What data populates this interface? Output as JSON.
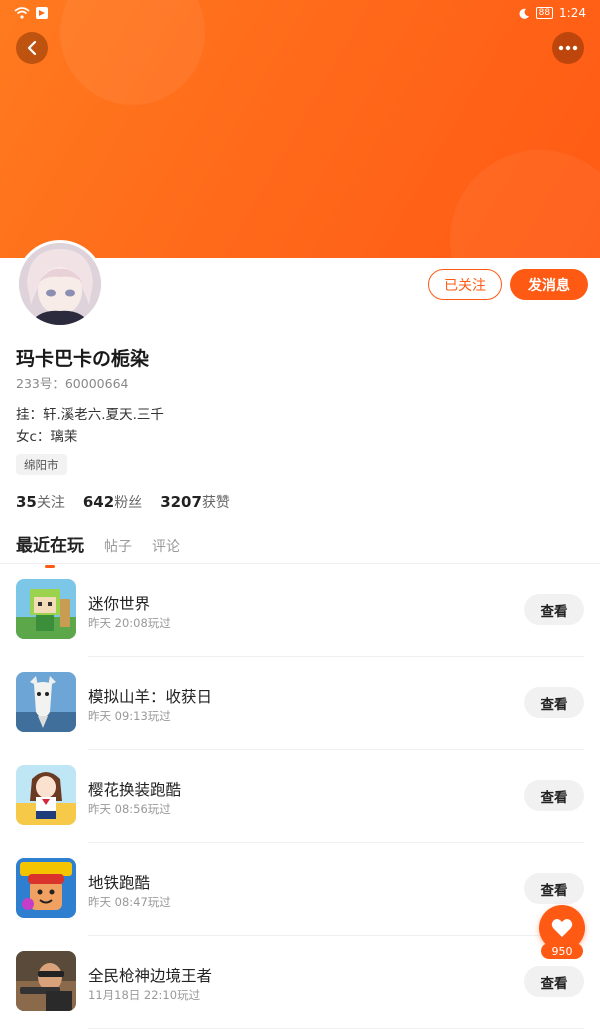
{
  "status_bar": {
    "time": "1:24",
    "battery": "88"
  },
  "profile": {
    "name": "玛卡巴卡の栀染",
    "uid": "233号：60000664",
    "bio_line1": "挂：轩.溪老六.夏天.三千",
    "bio_line2": "女c：璃茉",
    "city": "绵阳市"
  },
  "actions": {
    "followed_label": "已关注",
    "message_label": "发消息"
  },
  "stats": [
    {
      "count": "35",
      "label": "关注"
    },
    {
      "count": "642",
      "label": "粉丝"
    },
    {
      "count": "3207",
      "label": "获赞"
    }
  ],
  "tabs": [
    {
      "label": "最近在玩",
      "active": true
    },
    {
      "label": "帖子",
      "active": false
    },
    {
      "label": "评论",
      "active": false
    }
  ],
  "games": [
    {
      "title": "迷你世界",
      "played": "昨天 20:08玩过",
      "button": "查看",
      "icon": "mini-world-icon"
    },
    {
      "title": "模拟山羊：收获日",
      "played": "昨天 09:13玩过",
      "button": "查看",
      "icon": "goat-simulator-icon"
    },
    {
      "title": "樱花换装跑酷",
      "played": "昨天 08:56玩过",
      "button": "查看",
      "icon": "sakura-runner-icon"
    },
    {
      "title": "地铁跑酷",
      "played": "昨天 08:47玩过",
      "button": "查看",
      "icon": "subway-surfers-icon"
    },
    {
      "title": "全民枪神边境王者",
      "played": "11月18日 22:10玩过",
      "button": "查看",
      "icon": "gun-king-icon"
    }
  ],
  "floating": {
    "like_count": "950"
  },
  "colors": {
    "accent": "#ff5a14",
    "banner": "#ff6a1a"
  }
}
